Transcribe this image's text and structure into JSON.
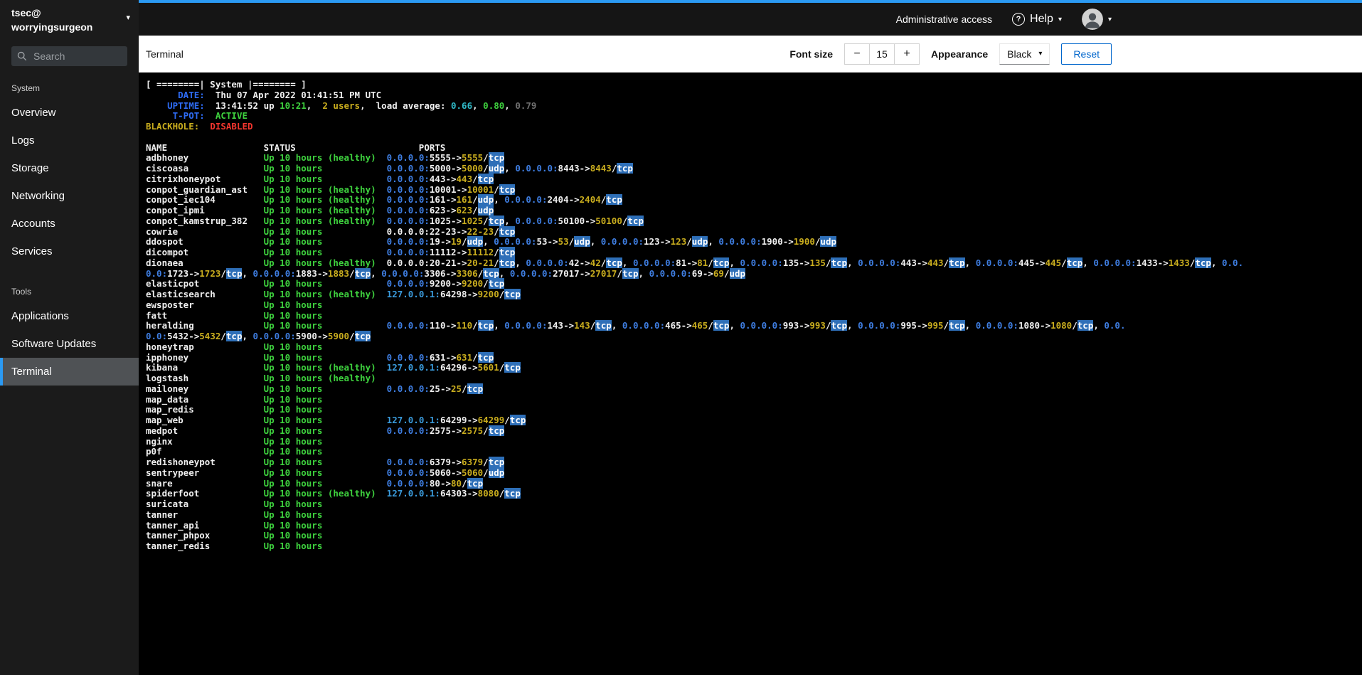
{
  "colors": {
    "accent-blue": "#2b9af3",
    "reset-blue": "#0066cc",
    "term-green": "#3ed13e",
    "term-yellow": "#c9ad1e",
    "term-blue": "#3e7de0",
    "term-blue-bright": "#2e6cf5",
    "term-cyan": "#2fb8c6",
    "term-cyan-blue": "#3a9bdc",
    "term-red": "#f2362e",
    "term-dim": "#6f6f6f",
    "term-highlight-bg": "#2e6fb8"
  },
  "sidebar": {
    "user": "tsec@",
    "host": "worryingsurgeon",
    "search_placeholder": "Search",
    "sections": [
      {
        "title": "System",
        "items": [
          "Overview",
          "Logs",
          "Storage",
          "Networking",
          "Accounts",
          "Services"
        ]
      },
      {
        "title": "Tools",
        "items": [
          "Applications",
          "Software Updates",
          "Terminal"
        ]
      }
    ]
  },
  "masthead": {
    "admin_access": "Administrative access",
    "help": "Help"
  },
  "toolbar": {
    "title": "Terminal",
    "font_size_label": "Font size",
    "font_size_value": "15",
    "decrease": "−",
    "increase": "+",
    "appearance_label": "Appearance",
    "theme": "Black",
    "reset": "Reset"
  },
  "terminal": {
    "info_lines": [
      [
        {
          "t": "[ ========| System |======== ]",
          "c": "w"
        }
      ],
      [
        {
          "t": "      DATE:",
          "c": "lb"
        },
        {
          "t": "  Thu 07 Apr 2022 01:41:51 PM UTC",
          "c": "w"
        }
      ],
      [
        {
          "t": "    UPTIME:",
          "c": "lb"
        },
        {
          "t": "  13:41:52 up ",
          "c": "w"
        },
        {
          "t": "10:21",
          "c": "g"
        },
        {
          "t": ",  ",
          "c": "w"
        },
        {
          "t": "2 users",
          "c": "y"
        },
        {
          "t": ",  load average: ",
          "c": "w"
        },
        {
          "t": "0.66",
          "c": "c"
        },
        {
          "t": ", ",
          "c": "w"
        },
        {
          "t": "0.80",
          "c": "g"
        },
        {
          "t": ", ",
          "c": "w"
        },
        {
          "t": "0.79",
          "c": "dim"
        }
      ],
      [
        {
          "t": "     T-POT:",
          "c": "lb"
        },
        {
          "t": "  ",
          "c": "w"
        },
        {
          "t": "ACTIVE",
          "c": "g"
        }
      ],
      [
        {
          "t": "BLACKHOLE:",
          "c": "y"
        },
        {
          "t": "  ",
          "c": "w"
        },
        {
          "t": "DISABLED",
          "c": "r"
        }
      ],
      []
    ],
    "columns": {
      "name": "NAME",
      "status": "STATUS",
      "ports": "PORTS"
    },
    "rows": [
      {
        "name": "adbhoney",
        "status": "Up 10 hours (healthy)",
        "ports": [
          {
            "ip": "0.0.0.0:",
            "src": "5555",
            "dst": "5555",
            "proto": "tcp"
          }
        ]
      },
      {
        "name": "ciscoasa",
        "status": "Up 10 hours",
        "ports": [
          {
            "ip": "0.0.0.0:",
            "src": "5000",
            "dst": "5000",
            "proto": "udp"
          },
          {
            "ip": "0.0.0.0:",
            "src": "8443",
            "dst": "8443",
            "proto": "tcp"
          }
        ]
      },
      {
        "name": "citrixhoneypot",
        "status": "Up 10 hours",
        "ports": [
          {
            "ip": "0.0.0.0:",
            "src": "443",
            "dst": "443",
            "proto": "tcp"
          }
        ]
      },
      {
        "name": "conpot_guardian_ast",
        "status": "Up 10 hours (healthy)",
        "ports": [
          {
            "ip": "0.0.0.0:",
            "src": "10001",
            "dst": "10001",
            "proto": "tcp"
          }
        ]
      },
      {
        "name": "conpot_iec104",
        "status": "Up 10 hours (healthy)",
        "ports": [
          {
            "ip": "0.0.0.0:",
            "src": "161",
            "dst": "161",
            "proto": "udp"
          },
          {
            "ip": "0.0.0.0:",
            "src": "2404",
            "dst": "2404",
            "proto": "tcp"
          }
        ]
      },
      {
        "name": "conpot_ipmi",
        "status": "Up 10 hours (healthy)",
        "ports": [
          {
            "ip": "0.0.0.0:",
            "src": "623",
            "dst": "623",
            "proto": "udp"
          }
        ]
      },
      {
        "name": "conpot_kamstrup_382",
        "status": "Up 10 hours (healthy)",
        "ports": [
          {
            "ip": "0.0.0.0:",
            "src": "1025",
            "dst": "1025",
            "proto": "tcp"
          },
          {
            "ip": "0.0.0.0:",
            "src": "50100",
            "dst": "50100",
            "proto": "tcp"
          }
        ]
      },
      {
        "name": "cowrie",
        "status": "Up 10 hours",
        "ports": [
          {
            "ip": "0.0.0.0:",
            "ipc": "w",
            "src": "22-23",
            "dst": "22-23",
            "proto": "tcp"
          }
        ]
      },
      {
        "name": "ddospot",
        "status": "Up 10 hours",
        "ports": [
          {
            "ip": "0.0.0.0:",
            "src": "19",
            "dst": "19",
            "proto": "udp"
          },
          {
            "ip": "0.0.0.0:",
            "src": "53",
            "dst": "53",
            "proto": "udp"
          },
          {
            "ip": "0.0.0.0:",
            "src": "123",
            "dst": "123",
            "proto": "udp"
          },
          {
            "ip": "0.0.0.0:",
            "src": "1900",
            "dst": "1900",
            "proto": "udp"
          }
        ]
      },
      {
        "name": "dicompot",
        "status": "Up 10 hours",
        "ports": [
          {
            "ip": "0.0.0.0:",
            "src": "11112",
            "dst": "11112",
            "proto": "tcp"
          }
        ]
      },
      {
        "name": "dionaea",
        "status": "Up 10 hours (healthy)",
        "ports": [
          {
            "ip": "0.0.0.0:",
            "ipc": "w",
            "src": "20-21",
            "dst": "20-21",
            "proto": "tcp"
          },
          {
            "ip": "0.0.0.0:",
            "src": "42",
            "dst": "42",
            "proto": "tcp"
          },
          {
            "ip": "0.0.0.0:",
            "src": "81",
            "dst": "81",
            "proto": "tcp"
          },
          {
            "ip": "0.0.0.0:",
            "src": "135",
            "dst": "135",
            "proto": "tcp"
          },
          {
            "ip": "0.0.0.0:",
            "src": "443",
            "dst": "443",
            "proto": "tcp"
          },
          {
            "ip": "0.0.0.0:",
            "src": "445",
            "dst": "445",
            "proto": "tcp"
          },
          {
            "ip": "0.0.0.0:",
            "src": "1433",
            "dst": "1433",
            "proto": "tcp"
          }
        ],
        "tail": "0.0."
      },
      {
        "cont": true,
        "ports": [
          {
            "ip": "0.0:",
            "src": "1723",
            "dst": "1723",
            "proto": "tcp"
          },
          {
            "ip": "0.0.0.0:",
            "src": "1883",
            "dst": "1883",
            "proto": "tcp"
          },
          {
            "ip": "0.0.0.0:",
            "src": "3306",
            "dst": "3306",
            "proto": "tcp"
          },
          {
            "ip": "0.0.0.0:",
            "src": "27017",
            "dst": "27017",
            "proto": "tcp"
          },
          {
            "ip": "0.0.0.0:",
            "src": "69",
            "dst": "69",
            "proto": "udp"
          }
        ]
      },
      {
        "name": "elasticpot",
        "status": "Up 10 hours",
        "ports": [
          {
            "ip": "0.0.0.0:",
            "src": "9200",
            "dst": "9200",
            "proto": "tcp"
          }
        ]
      },
      {
        "name": "elasticsearch",
        "status": "Up 10 hours (healthy)",
        "ports": [
          {
            "ip": "127.0.0.1:",
            "ipc": "bc",
            "src": "64298",
            "dst": "9200",
            "proto": "tcp"
          }
        ]
      },
      {
        "name": "ewsposter",
        "status": "Up 10 hours"
      },
      {
        "name": "fatt",
        "status": "Up 10 hours"
      },
      {
        "name": "heralding",
        "status": "Up 10 hours",
        "ports": [
          {
            "ip": "0.0.0.0:",
            "src": "110",
            "dst": "110",
            "proto": "tcp"
          },
          {
            "ip": "0.0.0.0:",
            "src": "143",
            "dst": "143",
            "proto": "tcp"
          },
          {
            "ip": "0.0.0.0:",
            "src": "465",
            "dst": "465",
            "proto": "tcp"
          },
          {
            "ip": "0.0.0.0:",
            "src": "993",
            "dst": "993",
            "proto": "tcp"
          },
          {
            "ip": "0.0.0.0:",
            "src": "995",
            "dst": "995",
            "proto": "tcp"
          },
          {
            "ip": "0.0.0.0:",
            "src": "1080",
            "dst": "1080",
            "proto": "tcp"
          }
        ],
        "tail": "0.0."
      },
      {
        "cont": true,
        "ports": [
          {
            "ip": "0.0:",
            "src": "5432",
            "dst": "5432",
            "proto": "tcp"
          },
          {
            "ip": "0.0.0.0:",
            "src": "5900",
            "dst": "5900",
            "proto": "tcp"
          }
        ]
      },
      {
        "name": "honeytrap",
        "status": "Up 10 hours"
      },
      {
        "name": "ipphoney",
        "status": "Up 10 hours",
        "ports": [
          {
            "ip": "0.0.0.0:",
            "src": "631",
            "dst": "631",
            "proto": "tcp"
          }
        ]
      },
      {
        "name": "kibana",
        "status": "Up 10 hours (healthy)",
        "ports": [
          {
            "ip": "127.0.0.1:",
            "ipc": "bc",
            "src": "64296",
            "dst": "5601",
            "proto": "tcp"
          }
        ]
      },
      {
        "name": "logstash",
        "status": "Up 10 hours (healthy)"
      },
      {
        "name": "mailoney",
        "status": "Up 10 hours",
        "ports": [
          {
            "ip": "0.0.0.0:",
            "src": "25",
            "dst": "25",
            "proto": "tcp"
          }
        ]
      },
      {
        "name": "map_data",
        "status": "Up 10 hours"
      },
      {
        "name": "map_redis",
        "status": "Up 10 hours"
      },
      {
        "name": "map_web",
        "status": "Up 10 hours",
        "ports": [
          {
            "ip": "127.0.0.1:",
            "ipc": "bc",
            "src": "64299",
            "dst": "64299",
            "proto": "tcp"
          }
        ]
      },
      {
        "name": "medpot",
        "status": "Up 10 hours",
        "ports": [
          {
            "ip": "0.0.0.0:",
            "src": "2575",
            "dst": "2575",
            "proto": "tcp"
          }
        ]
      },
      {
        "name": "nginx",
        "status": "Up 10 hours"
      },
      {
        "name": "p0f",
        "status": "Up 10 hours"
      },
      {
        "name": "redishoneypot",
        "status": "Up 10 hours",
        "ports": [
          {
            "ip": "0.0.0.0:",
            "src": "6379",
            "dst": "6379",
            "proto": "tcp"
          }
        ]
      },
      {
        "name": "sentrypeer",
        "status": "Up 10 hours",
        "ports": [
          {
            "ip": "0.0.0.0:",
            "src": "5060",
            "dst": "5060",
            "proto": "udp"
          }
        ]
      },
      {
        "name": "snare",
        "status": "Up 10 hours",
        "ports": [
          {
            "ip": "0.0.0.0:",
            "src": "80",
            "dst": "80",
            "proto": "tcp"
          }
        ]
      },
      {
        "name": "spiderfoot",
        "status": "Up 10 hours (healthy)",
        "ports": [
          {
            "ip": "127.0.0.1:",
            "ipc": "bc",
            "src": "64303",
            "dst": "8080",
            "proto": "tcp"
          }
        ]
      },
      {
        "name": "suricata",
        "status": "Up 10 hours"
      },
      {
        "name": "tanner",
        "status": "Up 10 hours"
      },
      {
        "name": "tanner_api",
        "status": "Up 10 hours"
      },
      {
        "name": "tanner_phpox",
        "status": "Up 10 hours"
      },
      {
        "name": "tanner_redis",
        "status": "Up 10 hours"
      }
    ]
  }
}
